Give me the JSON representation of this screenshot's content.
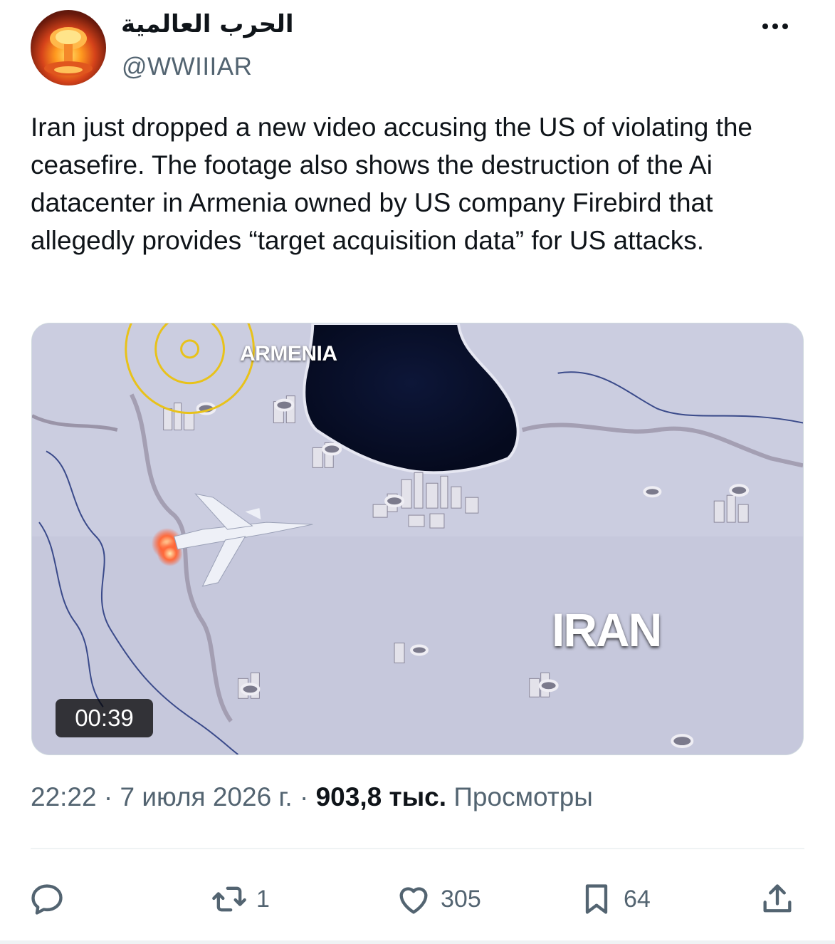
{
  "author": {
    "display_name": "الحرب العالمية",
    "handle": "@WWIIIAR",
    "avatar_icon": "nuclear-explosion-avatar"
  },
  "tweet": {
    "text": "Iran just dropped a new video accusing the US of violating the ceasefire. The footage also shows the destruction of the Ai datacenter in Armenia owned by US company Firebird that allegedly provides “target acquisition data” for US attacks."
  },
  "media": {
    "type": "video",
    "labels": {
      "armenia": "ARMENIA",
      "iran": "IRAN"
    },
    "duration": "00:39"
  },
  "meta": {
    "time": "22:22",
    "separator": "·",
    "date": "7 июля 2026 г.",
    "views_count": "903,8 тыс.",
    "views_label": "Просмотры"
  },
  "actions": {
    "reply": {
      "icon": "reply-icon",
      "count": ""
    },
    "retweet": {
      "icon": "retweet-icon",
      "count": "1"
    },
    "like": {
      "icon": "heart-icon",
      "count": "305"
    },
    "bookmark": {
      "icon": "bookmark-icon",
      "count": "64"
    },
    "share": {
      "icon": "share-icon"
    }
  },
  "colors": {
    "text_primary": "#0f1419",
    "text_secondary": "#536471",
    "divider": "#eff3f4",
    "map_ground": "#c9ccde",
    "map_lake": "#0a1230",
    "target_ring": "#e8c21a"
  }
}
